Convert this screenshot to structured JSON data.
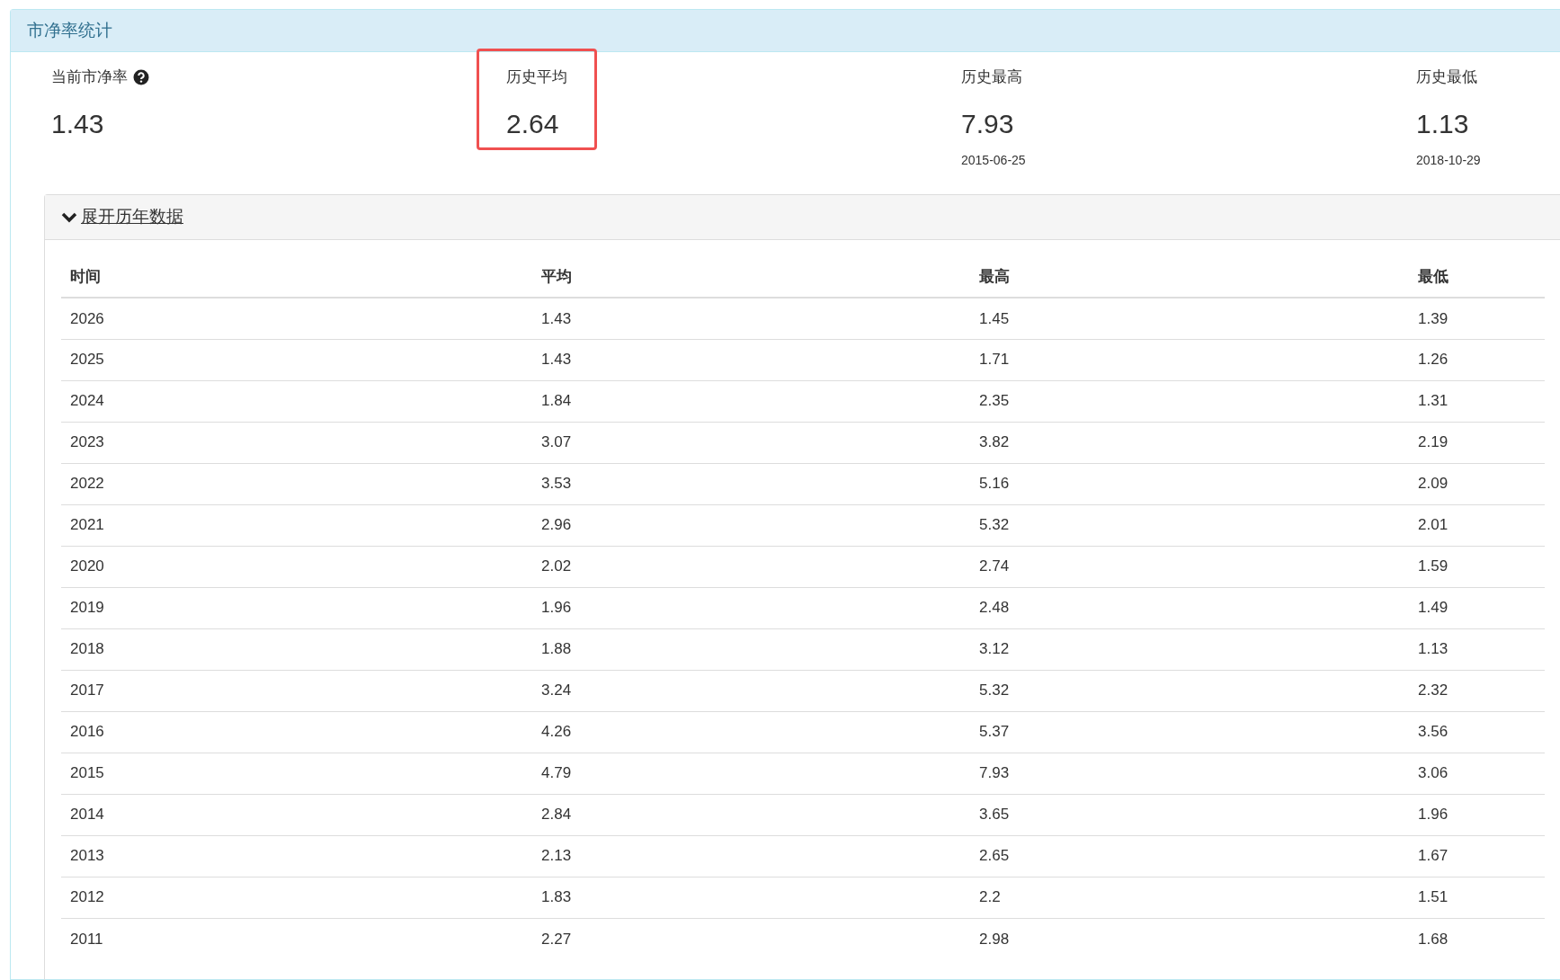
{
  "panel": {
    "title": "市净率统计"
  },
  "stats": [
    {
      "label": "当前市净率",
      "help": true,
      "value": "1.43",
      "highlighted": false
    },
    {
      "label": "历史平均",
      "help": false,
      "value": "2.64",
      "highlighted": true
    },
    {
      "label": "历史最高",
      "help": false,
      "value": "7.93",
      "date": "2015-06-25",
      "highlighted": false
    },
    {
      "label": "历史最低",
      "help": false,
      "value": "1.13",
      "date": "2018-10-29",
      "highlighted": false
    }
  ],
  "history": {
    "toggle": "展开历年数据",
    "expanded": true,
    "columns": [
      "时间",
      "平均",
      "最高",
      "最低"
    ],
    "rows": [
      [
        "2026",
        "1.43",
        "1.45",
        "1.39"
      ],
      [
        "2025",
        "1.43",
        "1.71",
        "1.26"
      ],
      [
        "2024",
        "1.84",
        "2.35",
        "1.31"
      ],
      [
        "2023",
        "3.07",
        "3.82",
        "2.19"
      ],
      [
        "2022",
        "3.53",
        "5.16",
        "2.09"
      ],
      [
        "2021",
        "2.96",
        "5.32",
        "2.01"
      ],
      [
        "2020",
        "2.02",
        "2.74",
        "1.59"
      ],
      [
        "2019",
        "1.96",
        "2.48",
        "1.49"
      ],
      [
        "2018",
        "1.88",
        "3.12",
        "1.13"
      ],
      [
        "2017",
        "3.24",
        "5.32",
        "2.32"
      ],
      [
        "2016",
        "4.26",
        "5.37",
        "3.56"
      ],
      [
        "2015",
        "4.79",
        "7.93",
        "3.06"
      ],
      [
        "2014",
        "2.84",
        "3.65",
        "1.96"
      ],
      [
        "2013",
        "2.13",
        "2.65",
        "1.67"
      ],
      [
        "2012",
        "1.83",
        "2.2",
        "1.51"
      ],
      [
        "2011",
        "2.27",
        "2.98",
        "1.68"
      ]
    ]
  }
}
